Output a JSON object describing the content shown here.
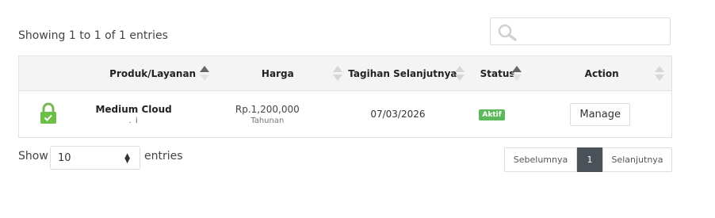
{
  "info_text": "Showing 1 to 1 of 1 entries",
  "search": {
    "icon": "search-icon",
    "placeholder": ""
  },
  "table": {
    "headers": [
      "Produk/Layanan",
      "Harga",
      "Tagihan Selanjutnya",
      "Status",
      "Action"
    ],
    "rows": [
      {
        "icon": "lock-icon",
        "product_name": "Medium Cloud",
        "product_sub": ". i",
        "price": "Rp.1,200,000",
        "cycle": "Tahunan",
        "next_due": "07/03/2026",
        "status": "Aktif",
        "action": "Manage"
      }
    ]
  },
  "length": {
    "show_label": "Show",
    "value": "10",
    "entries_label": "entries"
  },
  "pagination": {
    "prev": "Sebelumnya",
    "current": "1",
    "next": "Selanjutnya"
  },
  "colors": {
    "status_active": "#5cb85c",
    "lock_green": "#6cbf45",
    "pager_active": "#4a5159"
  }
}
